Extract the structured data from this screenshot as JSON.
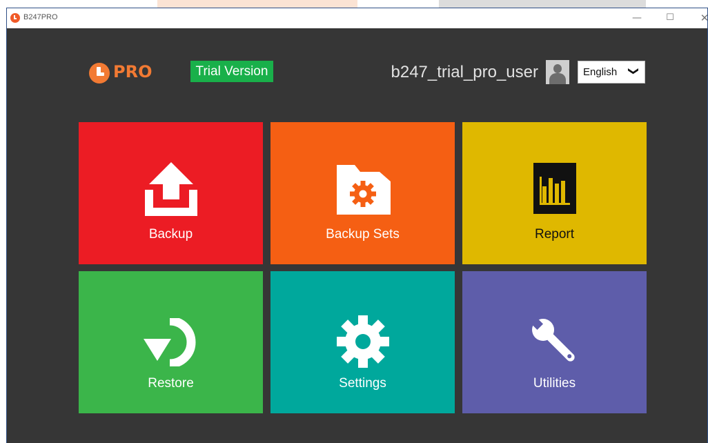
{
  "window": {
    "title": "B247PRO",
    "controls": {
      "minimize": "—",
      "maximize": "☐",
      "close": "✕"
    }
  },
  "header": {
    "logo_text": "PRO",
    "trial_badge": "Trial Version",
    "username": "b247_trial_pro_user",
    "language": {
      "selected": "English",
      "chevron": "❯"
    }
  },
  "tiles": [
    {
      "label": "Backup",
      "icon": "upload-icon",
      "color": "#ec1c24"
    },
    {
      "label": "Backup Sets",
      "icon": "folder-gear-icon",
      "color": "#f55f13"
    },
    {
      "label": "Report",
      "icon": "bar-chart-icon",
      "color": "#dfb800"
    },
    {
      "label": "Restore",
      "icon": "restore-arrow-icon",
      "color": "#3bb54a"
    },
    {
      "label": "Settings",
      "icon": "gear-icon",
      "color": "#00a89c"
    },
    {
      "label": "Utilities",
      "icon": "wrench-icon",
      "color": "#5e5daa"
    }
  ],
  "colors": {
    "background": "#363636",
    "brand_orange": "#f27a33",
    "trial_green": "#19b04a"
  }
}
